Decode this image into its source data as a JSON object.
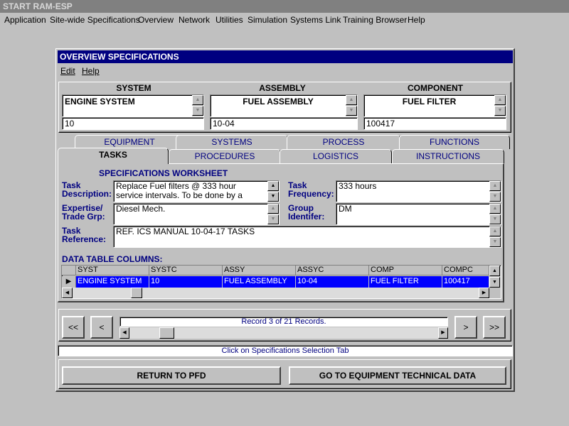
{
  "app": {
    "title": "START RAM-ESP",
    "menu": [
      "Application",
      "Site-wide Specifications",
      "Overview",
      "Network",
      "Utilities",
      "Simulation",
      "Systems Link",
      "Training Browser",
      "Help"
    ]
  },
  "window": {
    "title": "OVERVIEW SPECIFICATIONS",
    "menu": {
      "edit": "Edit",
      "help": "Help"
    }
  },
  "selection": {
    "system": {
      "header": "SYSTEM",
      "name": "ENGINE SYSTEM",
      "code": "10"
    },
    "assembly": {
      "header": "ASSEMBLY",
      "name": "FUEL ASSEMBLY",
      "code": "10-04"
    },
    "component": {
      "header": "COMPONENT",
      "name": "FUEL FILTER",
      "code": "100417"
    }
  },
  "tabs": {
    "back_row": [
      "EQUIPMENT",
      "SYSTEMS",
      "PROCESS",
      "FUNCTIONS"
    ],
    "front_row": [
      "TASKS",
      "PROCEDURES",
      "LOGISTICS",
      "INSTRUCTIONS"
    ],
    "active": "TASKS"
  },
  "worksheet": {
    "title": "SPECIFICATIONS WORKSHEET",
    "task_description": {
      "label1": "Task",
      "label2": "Description:",
      "line1": "Replace Fuel filters @ 333 hour",
      "line2": "service intervals. To be done by a"
    },
    "task_frequency": {
      "label1": "Task",
      "label2": "Frequency:",
      "value": "333 hours"
    },
    "trade_group": {
      "label1": "Expertise/",
      "label2": "Trade Grp:",
      "value": "Diesel Mech."
    },
    "group_identifier": {
      "label1": "Group",
      "label2": "Identifer:",
      "value": "DM"
    },
    "task_reference": {
      "label1": "Task",
      "label2": "Reference:",
      "value": "REF. ICS MANUAL 10-04-17 TASKS"
    }
  },
  "data_table": {
    "title": "DATA TABLE COLUMNS:",
    "columns": [
      "SYST",
      "SYSTC",
      "ASSY",
      "ASSYC",
      "COMP",
      "COMPC"
    ],
    "row": [
      "ENGINE SYSTEM",
      "10",
      "FUEL ASSEMBLY",
      "10-04",
      "FUEL FILTER",
      "100417"
    ]
  },
  "navigation": {
    "first": "<<",
    "prev": "<",
    "next": ">",
    "last": ">>",
    "record_status": "Record 3 of 21 Records."
  },
  "status_message": "Click on Specifications Selection Tab",
  "buttons": {
    "return": "RETURN TO PFD",
    "equipment": "GO TO EQUIPMENT TECHNICAL DATA"
  }
}
